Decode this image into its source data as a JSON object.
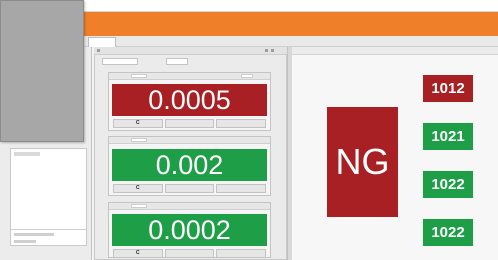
{
  "colors": {
    "accent_bar": "#f07f2a",
    "ng_red": "#a81f24",
    "ok_green": "#1f9e48"
  },
  "measurements": [
    {
      "value": "0.0005",
      "status_color": "#a81f24",
      "buttons": [
        "C",
        "",
        ""
      ]
    },
    {
      "value": "0.002",
      "status_color": "#1f9e48",
      "buttons": [
        "C",
        "",
        ""
      ]
    },
    {
      "value": "0.0002",
      "status_color": "#1f9e48",
      "buttons": [
        "C",
        "",
        ""
      ]
    }
  ],
  "result": {
    "label": "NG",
    "color": "#a81f24"
  },
  "codes": [
    {
      "value": "1012",
      "color": "#a81f24"
    },
    {
      "value": "1021",
      "color": "#1f9e48"
    },
    {
      "value": "1022",
      "color": "#1f9e48"
    },
    {
      "value": "1022",
      "color": "#1f9e48"
    }
  ],
  "icons": {
    "toolbar": "toolbar-icon",
    "panel_menu": "panel-menu-icon"
  }
}
